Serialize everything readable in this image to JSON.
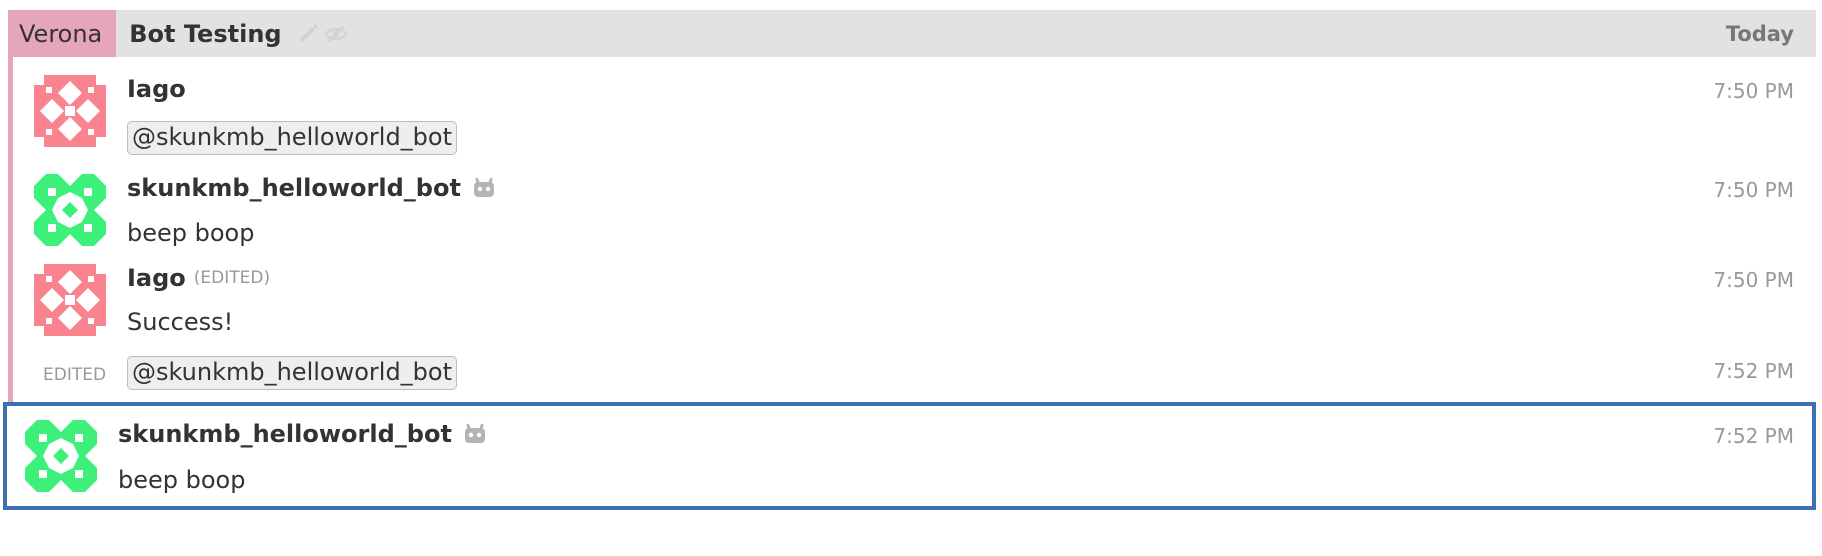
{
  "header": {
    "stream": "Verona",
    "topic": "Bot Testing",
    "date": "Today",
    "stream_color": "#e6a6ba"
  },
  "messages": [
    {
      "sender": "Iago",
      "content_mention": "@skunkmb_helloworld_bot",
      "time": "7:50 PM",
      "avatar": "iago-pink-avatar"
    },
    {
      "sender": "skunkmb_helloworld_bot",
      "content": "beep boop",
      "time": "7:50 PM",
      "avatar": "bot-green-avatar",
      "bot_icon": "bot-icon"
    },
    {
      "sender": "Iago",
      "edited_label": "(EDITED)",
      "content": "Success!",
      "time": "7:50 PM",
      "avatar": "iago-pink-avatar"
    },
    {
      "side_label": "EDITED",
      "content_mention": "@skunkmb_helloworld_bot",
      "time": "7:52 PM"
    },
    {
      "sender": "skunkmb_helloworld_bot",
      "content": "beep boop",
      "time": "7:52 PM",
      "avatar": "bot-green-avatar",
      "bot_icon": "bot-icon",
      "selected": true
    }
  ],
  "colors": {
    "selected_border": "#3b6eb3",
    "pink_avatar": "#f9848f",
    "green_avatar": "#3cf07a"
  }
}
